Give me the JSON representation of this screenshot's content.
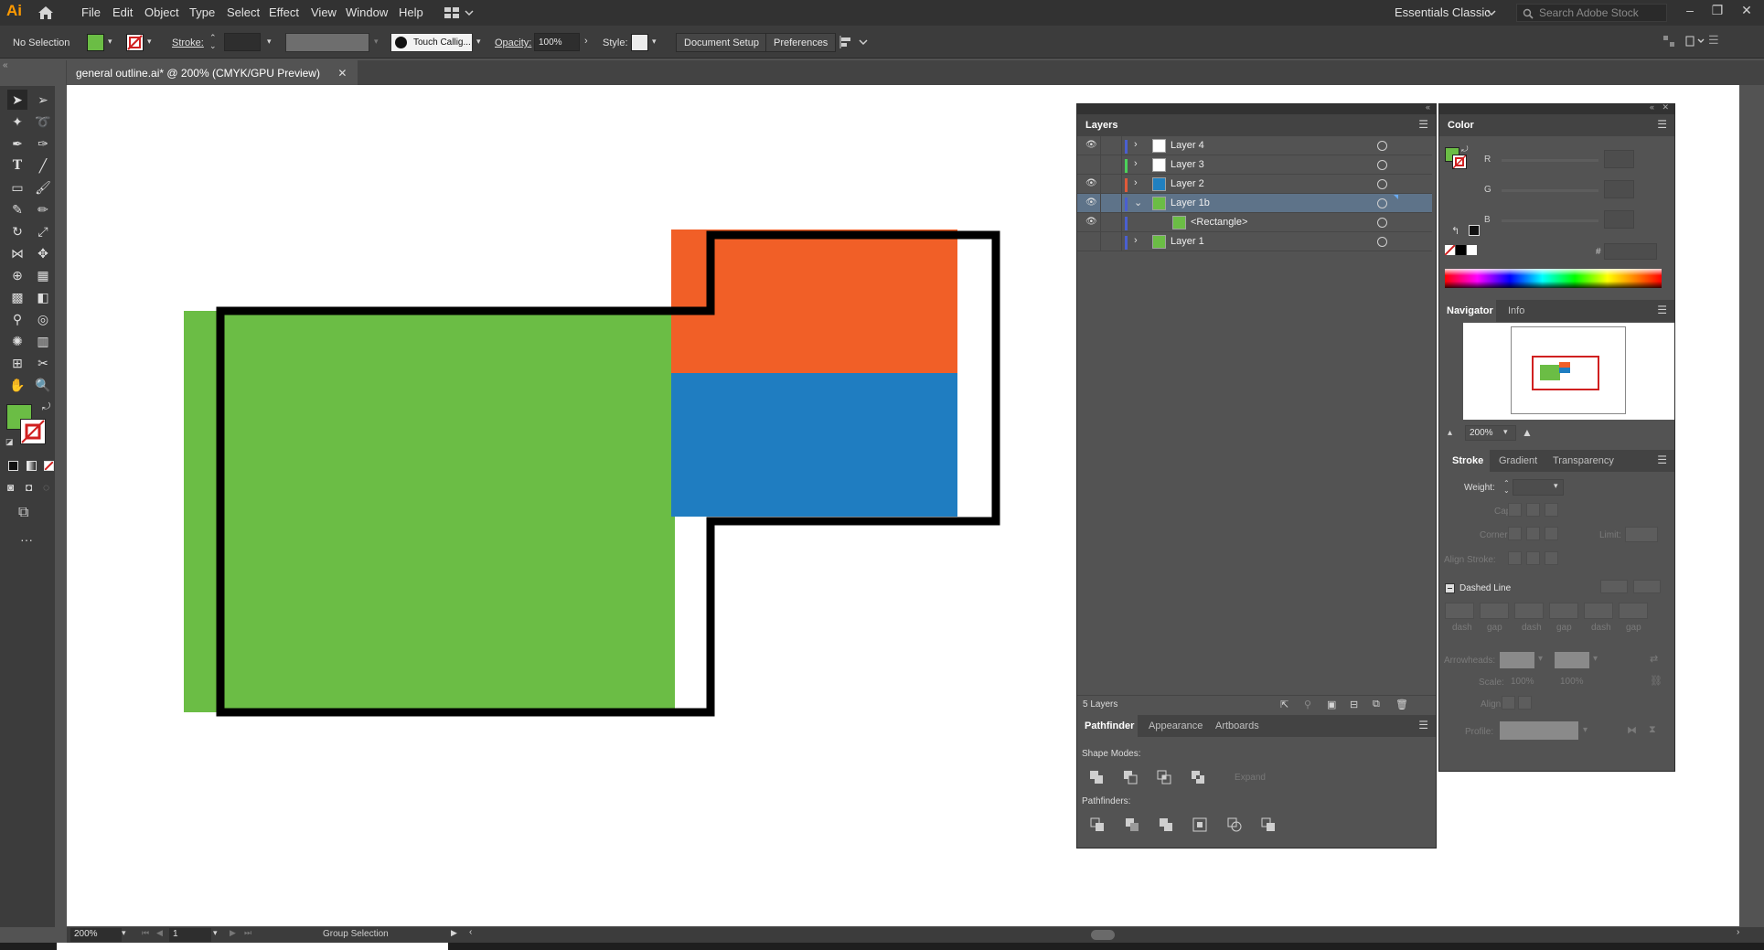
{
  "app": {
    "logo": "Ai",
    "menu": [
      "File",
      "Edit",
      "Object",
      "Type",
      "Select",
      "Effect",
      "View",
      "Window",
      "Help"
    ],
    "workspace": "Essentials Classic",
    "search_placeholder": "Search Adobe Stock"
  },
  "control_bar": {
    "selection": "No Selection",
    "stroke_label": "Stroke:",
    "brush": "Touch Callig...",
    "opacity_label": "Opacity:",
    "opacity_value": "100%",
    "style_label": "Style:",
    "document_setup": "Document Setup",
    "preferences": "Preferences"
  },
  "document": {
    "tab_title": "general outline.ai* @ 200% (CMYK/GPU Preview)"
  },
  "colors": {
    "green": "#6bbd45",
    "orange": "#f15f27",
    "blue": "#1f7dc1",
    "outline": "#000000"
  },
  "layers_panel": {
    "title": "Layers",
    "rows": [
      {
        "name": "Layer 4",
        "color": "#4a5fd0",
        "thumb": "#ffffff",
        "eye": true
      },
      {
        "name": "Layer 3",
        "color": "#4cd25a",
        "thumb": "#ffffff",
        "eye": false
      },
      {
        "name": "Layer 2",
        "color": "#e05a3a",
        "thumb": "#2080c0",
        "eye": true
      },
      {
        "name": "Layer 1b",
        "color": "#4a5fd0",
        "thumb": "#6bbd45",
        "eye": true
      },
      {
        "name": "<Rectangle>",
        "color": "#4a5fd0",
        "thumb": "#6bbd45",
        "eye": true
      },
      {
        "name": "Layer 1",
        "color": "#4a5fd0",
        "thumb": "#6bbd45",
        "eye": false
      }
    ],
    "count": "5 Layers"
  },
  "pathfinder_panel": {
    "tabs": [
      "Pathfinder",
      "Appearance",
      "Artboards"
    ],
    "shape_modes": "Shape Modes:",
    "expand": "Expand",
    "pathfinders": "Pathfinders:"
  },
  "color_panel": {
    "title": "Color",
    "channels": [
      "R",
      "G",
      "B"
    ],
    "hash": "#"
  },
  "navigator_panel": {
    "tabs": [
      "Navigator",
      "Info"
    ],
    "zoom": "200%"
  },
  "stroke_panel": {
    "tabs": [
      "Stroke",
      "Gradient",
      "Transparency"
    ],
    "weight": "Weight:",
    "cap": "Cap:",
    "corner": "Corner:",
    "limit": "Limit:",
    "align_stroke": "Align Stroke:",
    "dashed_line": "Dashed Line",
    "dash_labels": [
      "dash",
      "gap",
      "dash",
      "gap",
      "dash",
      "gap"
    ],
    "arrowheads": "Arrowheads:",
    "scale": "Scale:",
    "scale_values": [
      "100%",
      "100%"
    ],
    "align": "Align:",
    "profile": "Profile:"
  },
  "status_bar": {
    "zoom": "200%",
    "artboard": "1",
    "tool": "Group Selection"
  }
}
